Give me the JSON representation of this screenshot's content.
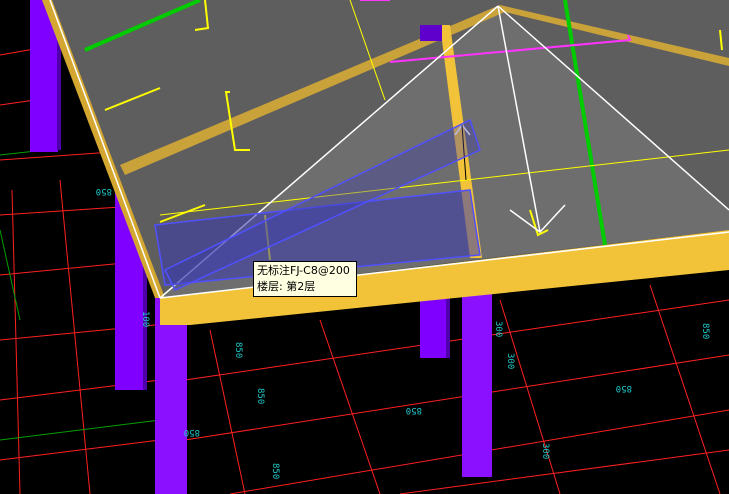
{
  "tooltip": {
    "line1": "无标注FJ-C8@200",
    "line2": "楼层: 第2层"
  },
  "dimensions": {
    "labels": [
      "850",
      "850",
      "850",
      "850",
      "850",
      "850",
      "300",
      "300",
      "300",
      "850",
      "850",
      "100"
    ]
  },
  "colors": {
    "background": "#000000",
    "column": "#8000ff",
    "beam": "#f0c030",
    "slab": "#5a5a5a",
    "rebar_yellow": "#ffff00",
    "rebar_green": "#00cc00",
    "rebar_magenta": "#ff33ff",
    "grid_red": "#ff0000",
    "grid_green": "#00aa00",
    "selection": "#5050ff",
    "dimension_text": "#1fc7c7",
    "tooltip_bg": "#ffffe1"
  }
}
